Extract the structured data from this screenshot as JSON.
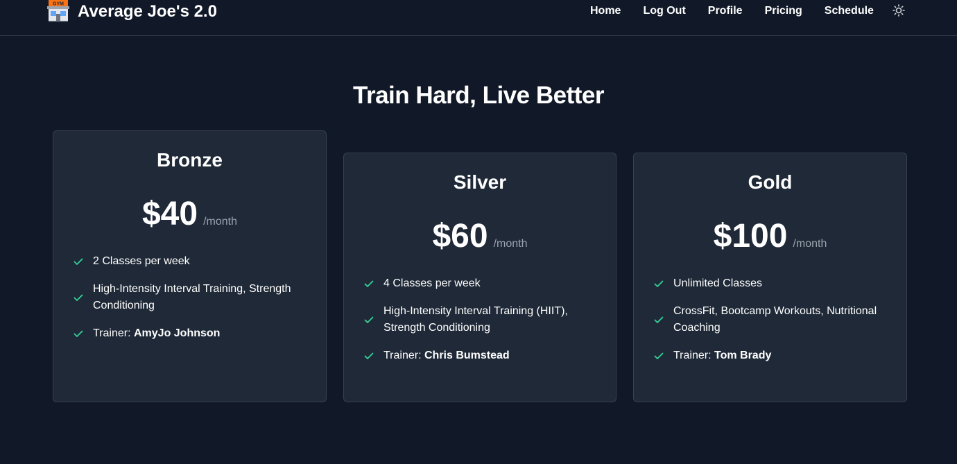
{
  "brand": {
    "name": "Average Joe's 2.0",
    "logo_text": "GYM"
  },
  "nav": {
    "links": [
      "Home",
      "Log Out",
      "Profile",
      "Pricing",
      "Schedule"
    ],
    "theme_icon": "sun-icon"
  },
  "hero": {
    "title": "Train Hard, Live Better"
  },
  "colors": {
    "background": "#111827",
    "card": "#1f2937",
    "check": "#34d399",
    "muted": "#9ca3af"
  },
  "plans": [
    {
      "tier": "Bronze",
      "price": "$40",
      "period": "/month",
      "features": [
        "2 Classes per week",
        "High-Intensity Interval Training, Strength Conditioning"
      ],
      "trainer_label": "Trainer:",
      "trainer": "AmyJo Johnson"
    },
    {
      "tier": "Silver",
      "price": "$60",
      "period": "/month",
      "features": [
        "4 Classes per week",
        "High-Intensity Interval Training (HIIT), Strength Conditioning"
      ],
      "trainer_label": "Trainer:",
      "trainer": "Chris Bumstead"
    },
    {
      "tier": "Gold",
      "price": "$100",
      "period": "/month",
      "features": [
        "Unlimited Classes",
        "CrossFit, Bootcamp Workouts, Nutritional Coaching"
      ],
      "trainer_label": "Trainer:",
      "trainer": "Tom Brady"
    }
  ]
}
